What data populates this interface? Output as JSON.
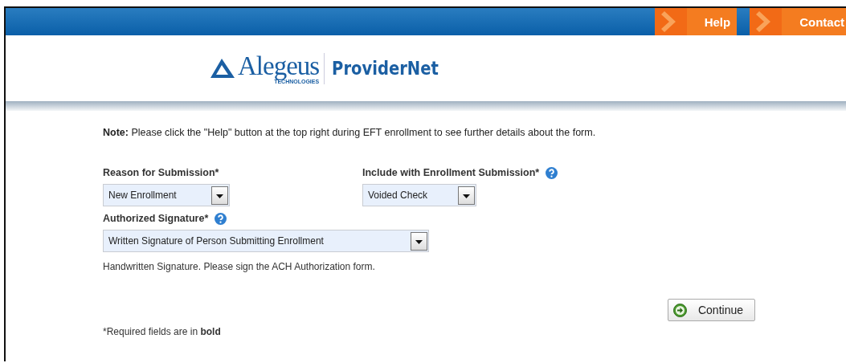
{
  "nav": [
    {
      "label": "Help"
    },
    {
      "label": "Contact"
    }
  ],
  "logo": {
    "brand": "Alegeus",
    "tagline": "TECHNOLOGIES",
    "product": "ProviderNet"
  },
  "note": "**Note:** Please click the \"Help\" button at the top right during EFT enrollment to see further details about the form.",
  "fields": [
    {
      "label": "Reason for Submission*",
      "value": "New Enrollment",
      "help": false
    },
    {
      "label": "Include with Enrollment Submission*",
      "value": "Voided Check",
      "help": true
    }
  ],
  "signature": {
    "label": "Authorized Signature*",
    "value": "Written Signature of Person Submitting Enrollment",
    "help": true,
    "hint": "Handwritten Signature. Please sign the ACH Authorization form."
  },
  "continue_button": "Continue",
  "footnote": "*Required fields are in **bold**"
}
